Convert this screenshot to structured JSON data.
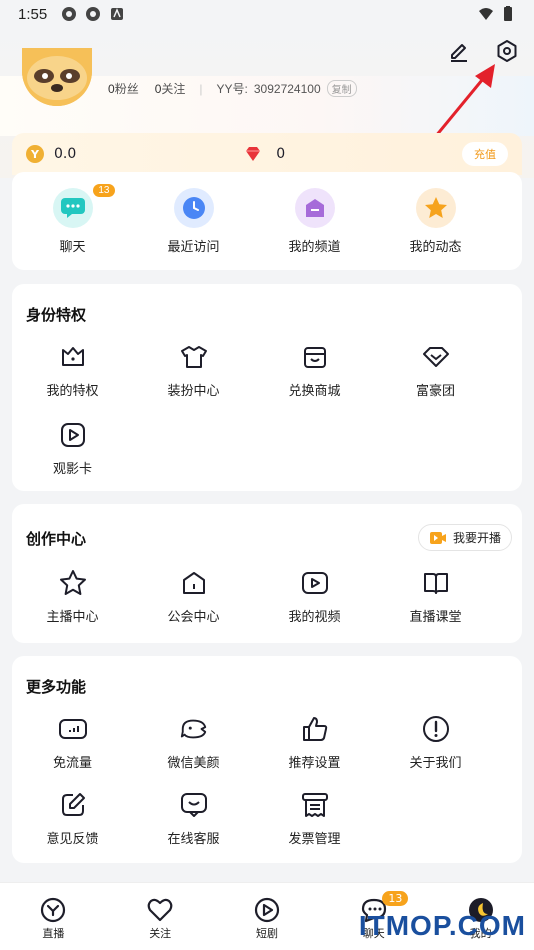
{
  "status_bar": {
    "time": "1:55"
  },
  "profile": {
    "fans_count": "0",
    "fans_label": "粉丝",
    "follow_count": "0",
    "follow_label": "关注",
    "yy_label": "YY号:",
    "yy_id": "3092724100",
    "copy_label": "复制"
  },
  "wallet": {
    "coins": "0.0",
    "diamonds": "0",
    "recharge_label": "充值"
  },
  "quick_actions": [
    {
      "label": "聊天",
      "badge": "13",
      "icon": "chat-icon"
    },
    {
      "label": "最近访问",
      "icon": "clock-icon"
    },
    {
      "label": "我的频道",
      "icon": "channel-icon"
    },
    {
      "label": "我的动态",
      "icon": "star-icon"
    }
  ],
  "identity_section": {
    "title": "身份特权",
    "items": [
      {
        "label": "我的特权",
        "icon": "crown-icon"
      },
      {
        "label": "装扮中心",
        "icon": "shirt-icon"
      },
      {
        "label": "兑换商城",
        "icon": "store-icon"
      },
      {
        "label": "富豪团",
        "icon": "diamond-icon"
      },
      {
        "label": "观影卡",
        "icon": "play-card-icon"
      }
    ]
  },
  "creator_section": {
    "title": "创作中心",
    "live_button": "我要开播",
    "items": [
      {
        "label": "主播中心",
        "icon": "star-outline-icon"
      },
      {
        "label": "公会中心",
        "icon": "house-icon"
      },
      {
        "label": "我的视频",
        "icon": "video-icon"
      },
      {
        "label": "直播课堂",
        "icon": "book-icon"
      }
    ]
  },
  "more_section": {
    "title": "更多功能",
    "items": [
      {
        "label": "免流量",
        "icon": "data-icon"
      },
      {
        "label": "微信美颜",
        "icon": "beauty-icon"
      },
      {
        "label": "推荐设置",
        "icon": "thumbs-up-icon"
      },
      {
        "label": "关于我们",
        "icon": "info-icon"
      },
      {
        "label": "意见反馈",
        "icon": "feedback-icon"
      },
      {
        "label": "在线客服",
        "icon": "service-icon"
      },
      {
        "label": "发票管理",
        "icon": "invoice-icon"
      }
    ]
  },
  "bottom_nav": [
    {
      "label": "直播",
      "icon": "live-icon"
    },
    {
      "label": "关注",
      "icon": "heart-icon"
    },
    {
      "label": "短剧",
      "icon": "play-icon"
    },
    {
      "label": "聊天",
      "icon": "chat-nav-icon",
      "badge": "13"
    },
    {
      "label": "我的",
      "icon": "me-avatar-icon"
    }
  ],
  "watermark": "ITMOP.COM",
  "colors": {
    "accent": "#f7a31c",
    "text": "#1e1e2a",
    "arrow": "#e3212b"
  }
}
